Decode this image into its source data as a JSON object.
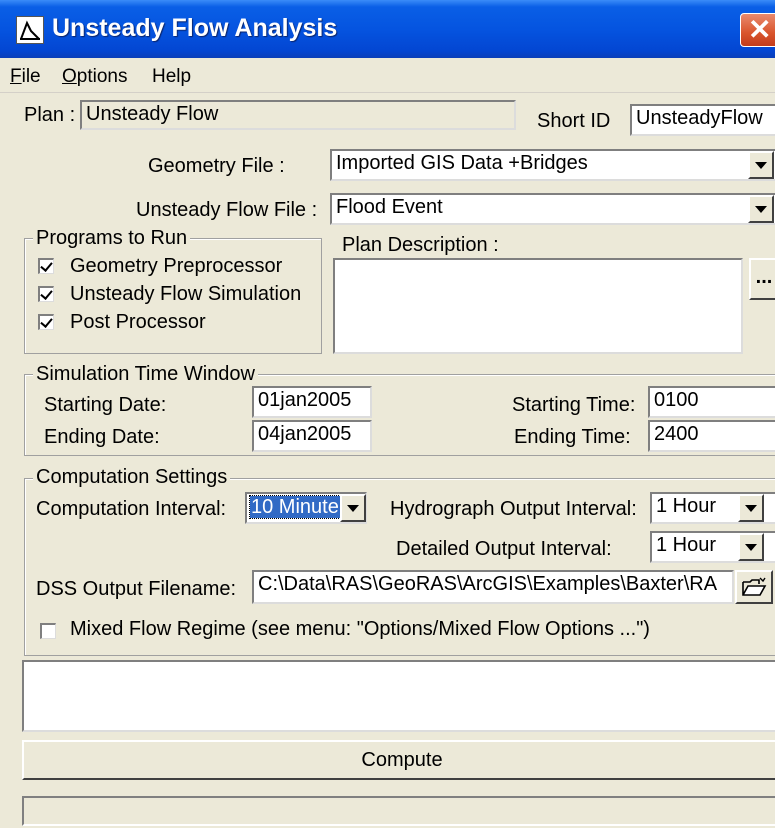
{
  "window": {
    "title": "Unsteady Flow Analysis",
    "close_glyph": "✕"
  },
  "menu": [
    {
      "label": "File"
    },
    {
      "label": "Options"
    },
    {
      "label": "Help"
    }
  ],
  "plan": {
    "label": "Plan :",
    "value": "Unsteady Flow",
    "short_id_label": "Short ID",
    "short_id_value": "UnsteadyFlow"
  },
  "geometry": {
    "label": "Geometry File :",
    "value": "Imported GIS Data +Bridges"
  },
  "unsteady": {
    "label": "Unsteady Flow File :",
    "value": "Flood Event"
  },
  "programs": {
    "title": "Programs to Run",
    "items": [
      {
        "label": "Geometry Preprocessor",
        "checked": true
      },
      {
        "label": "Unsteady Flow Simulation",
        "checked": true
      },
      {
        "label": "Post Processor",
        "checked": true
      }
    ]
  },
  "plan_description": {
    "label": "Plan Description :",
    "value": "",
    "more_button": "..."
  },
  "time_window": {
    "title": "Simulation Time Window",
    "starting_date_label": "Starting Date:",
    "starting_date": "01jan2005",
    "ending_date_label": "Ending Date:",
    "ending_date": "04jan2005",
    "starting_time_label": "Starting Time:",
    "starting_time": "0100",
    "ending_time_label": "Ending Time:",
    "ending_time": "2400"
  },
  "computation": {
    "title": "Computation Settings",
    "interval_label": "Computation Interval:",
    "interval_value": "10 Minute",
    "hydrograph_label": "Hydrograph Output Interval:",
    "hydrograph_value": "1 Hour",
    "detailed_label": "Detailed Output Interval:",
    "detailed_value": "1 Hour",
    "dss_label": "DSS Output Filename:",
    "dss_value": "C:\\Data\\RAS\\GeoRAS\\ArcGIS\\Examples\\Baxter\\RA",
    "mixed_label": "Mixed Flow Regime (see menu: \"Options/Mixed Flow Options ...\")",
    "mixed_checked": false
  },
  "messages": {
    "value": ""
  },
  "compute_button": "Compute",
  "status_bar": ""
}
